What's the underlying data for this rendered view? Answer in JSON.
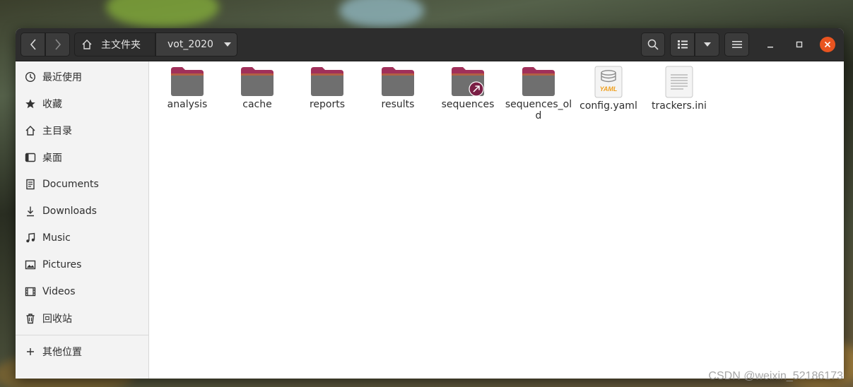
{
  "colors": {
    "accent": "#e95420",
    "folder_tab": "#a0305a",
    "folder_body": "#6f6f6f",
    "headerbar": "#2d2d2d"
  },
  "breadcrumb": {
    "home_label": "主文件夹",
    "current_label": "vot_2020"
  },
  "toolbar": {
    "back_icon": "chevron-left-icon",
    "forward_icon": "chevron-right-icon",
    "search_icon": "search-icon",
    "view_icon": "list-view-icon",
    "view_menu_icon": "chevron-down-icon",
    "menu_icon": "hamburger-menu-icon"
  },
  "sidebar": {
    "items": [
      {
        "label": "最近使用",
        "icon": "clock-icon"
      },
      {
        "label": "收藏",
        "icon": "star-icon"
      },
      {
        "label": "主目录",
        "icon": "home-icon"
      },
      {
        "label": "桌面",
        "icon": "desktop-icon"
      },
      {
        "label": "Documents",
        "icon": "document-icon"
      },
      {
        "label": "Downloads",
        "icon": "download-icon"
      },
      {
        "label": "Music",
        "icon": "music-icon"
      },
      {
        "label": "Pictures",
        "icon": "picture-icon"
      },
      {
        "label": "Videos",
        "icon": "video-icon"
      },
      {
        "label": "回收站",
        "icon": "trash-icon"
      },
      {
        "label": "其他位置",
        "icon": "plus-icon"
      }
    ]
  },
  "files": [
    {
      "name": "analysis",
      "type": "folder"
    },
    {
      "name": "cache",
      "type": "folder"
    },
    {
      "name": "reports",
      "type": "folder"
    },
    {
      "name": "results",
      "type": "folder"
    },
    {
      "name": "sequences",
      "type": "folder-link"
    },
    {
      "name": "sequences_old",
      "type": "folder"
    },
    {
      "name": "config.yaml",
      "type": "yaml",
      "badge": "YAML"
    },
    {
      "name": "trackers.ini",
      "type": "text"
    }
  ],
  "watermark": "CSDN @weixin_52186173"
}
